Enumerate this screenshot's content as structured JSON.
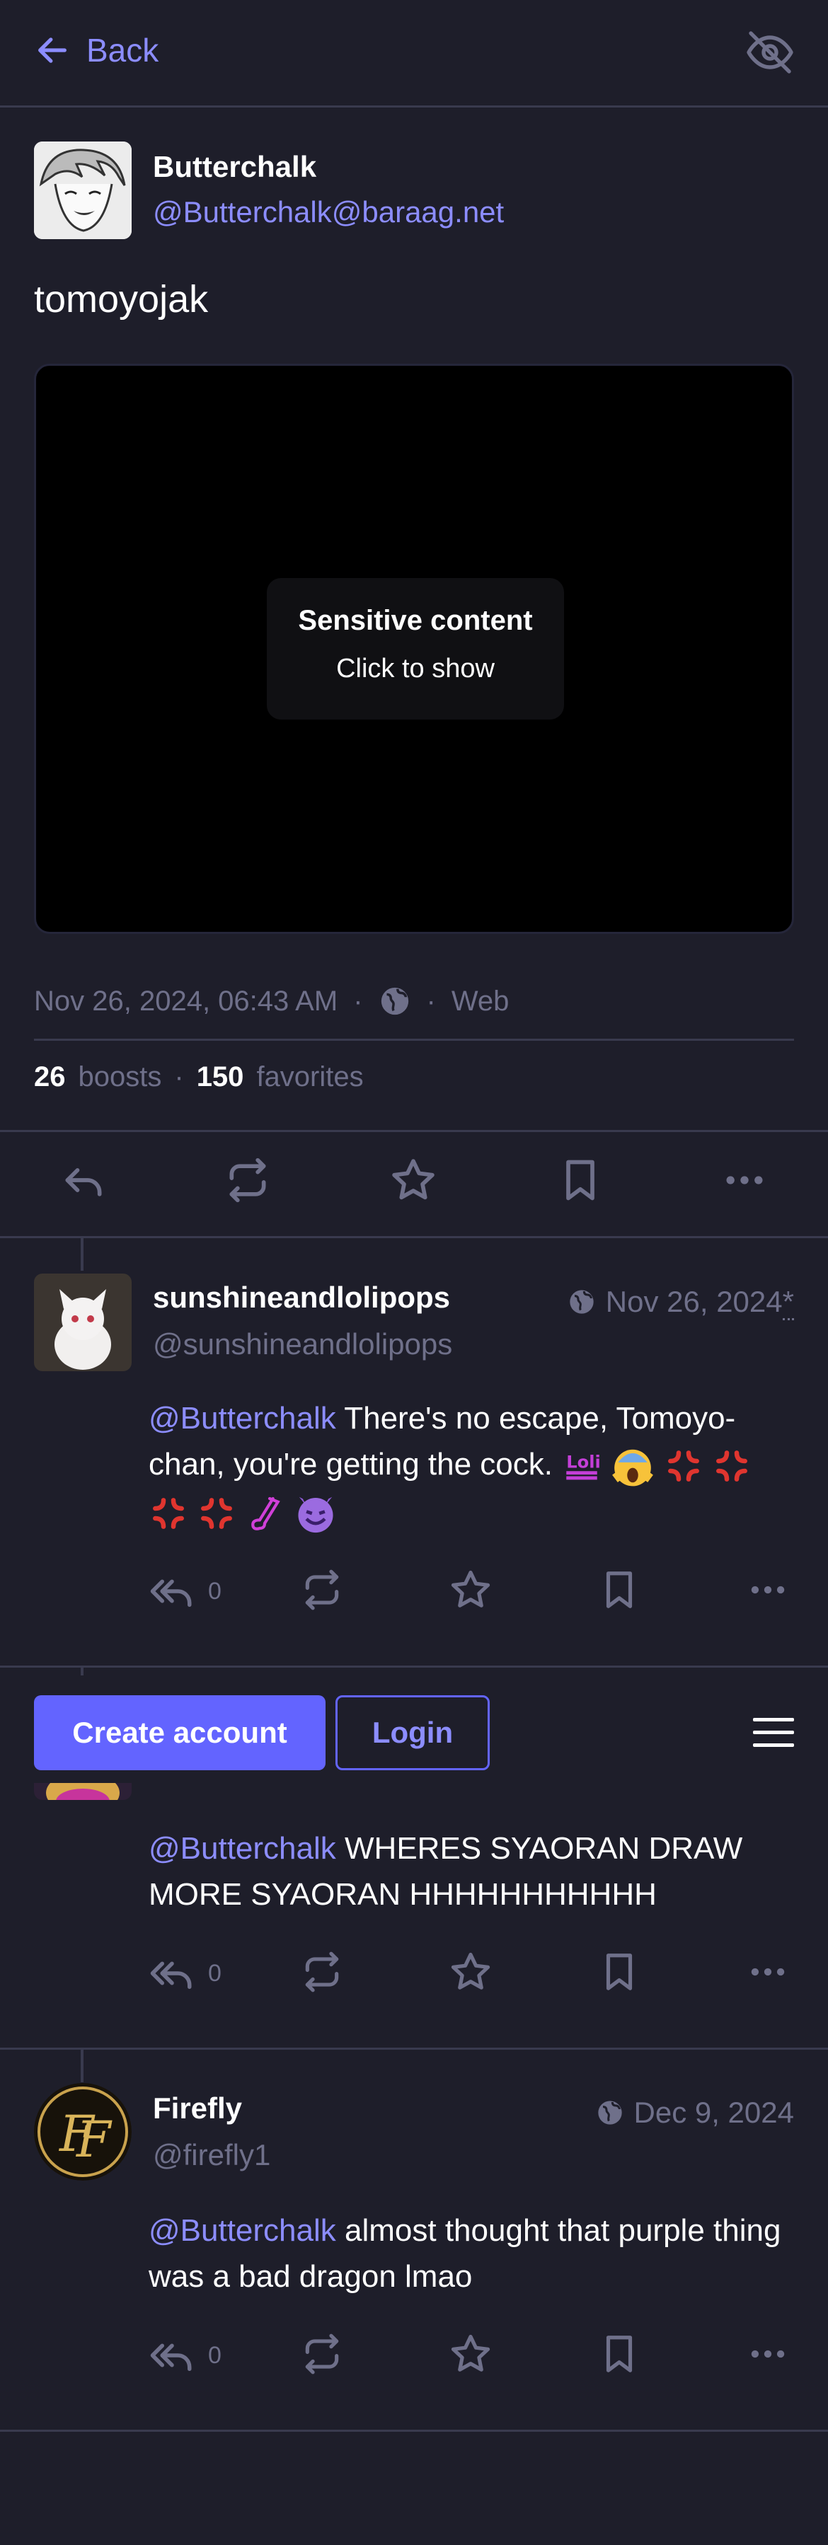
{
  "header": {
    "back_label": "Back"
  },
  "status": {
    "display_name": "Butterchalk",
    "acct": "@Butterchalk@baraag.net",
    "content": "tomoyojak",
    "media": {
      "spoiler_title": "Sensitive content",
      "spoiler_hint": "Click to show"
    },
    "date": "Nov 26, 2024, 06:43 AM",
    "separator": "·",
    "application": "Web",
    "boosts_count": "26",
    "boosts_label": "boosts",
    "favorites_count": "150",
    "favorites_label": "favorites"
  },
  "replies": [
    {
      "display_name": "sunshineandlolipops",
      "acct": "@sunshineandlolipops",
      "date": "Nov 26, 2024",
      "edited_marker": "*",
      "mention": "@Butterchalk",
      "text": "There's no escape, Tomoyo-chan, you're getting the cock.",
      "reply_count": "0"
    },
    {
      "mention": "@Butterchalk",
      "text": "WHERES SYAORAN DRAW MORE SYAORAN HHHHHHHHHHH",
      "reply_count": "0"
    },
    {
      "display_name": "Firefly",
      "acct": "@firefly1",
      "date": "Dec 9, 2024",
      "mention": "@Butterchalk",
      "text": "almost thought that purple thing was a bad dragon lmao",
      "reply_count": "0"
    }
  ],
  "signup_bar": {
    "create_label": "Create account",
    "login_label": "Login"
  },
  "colors": {
    "accent": "#8c8dff",
    "button": "#6364ff",
    "background": "#1e1e2a",
    "muted": "#6f708a"
  }
}
